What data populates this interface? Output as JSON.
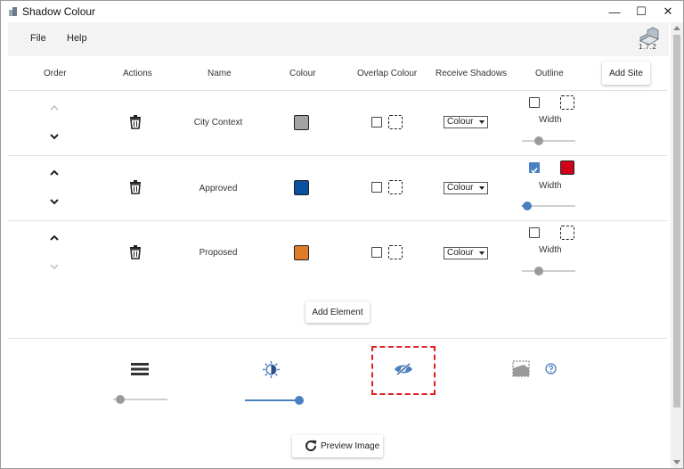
{
  "window": {
    "title": "Shadow Colour",
    "minimize": "—",
    "maximize": "☐",
    "close": "✕"
  },
  "menu": {
    "file": "File",
    "help": "Help"
  },
  "app": {
    "version": "1.7.2"
  },
  "table": {
    "headers": {
      "order": "Order",
      "actions": "Actions",
      "name": "Name",
      "colour": "Colour",
      "overlap": "Overlap Colour",
      "receive": "Receive Shadows",
      "outline": "Outline"
    },
    "add_site_label": "Add Site",
    "rows": [
      {
        "name": "City Context",
        "colour": "#a3a3a3",
        "overlap_checked": false,
        "receive": "Colour",
        "outline_checked": false,
        "outline_colour": "none",
        "width_label": "Width",
        "width_value": 0.32
      },
      {
        "name": "Approved",
        "colour": "#0b4fa0",
        "overlap_checked": false,
        "receive": "Colour",
        "outline_checked": true,
        "outline_colour": "#d0021b",
        "width_label": "Width",
        "width_value": 0.1
      },
      {
        "name": "Proposed",
        "colour": "#e07b2a",
        "overlap_checked": false,
        "receive": "Colour",
        "outline_checked": false,
        "outline_colour": "none",
        "width_label": "Width",
        "width_value": 0.32
      }
    ]
  },
  "add_element_label": "Add Element",
  "tools": {
    "layers_slider": 0.13,
    "brightness_slider": 1.0
  },
  "preview_label": "Preview Image",
  "colors": {
    "accent": "#4a7fc1",
    "highlight": "#e02020"
  }
}
